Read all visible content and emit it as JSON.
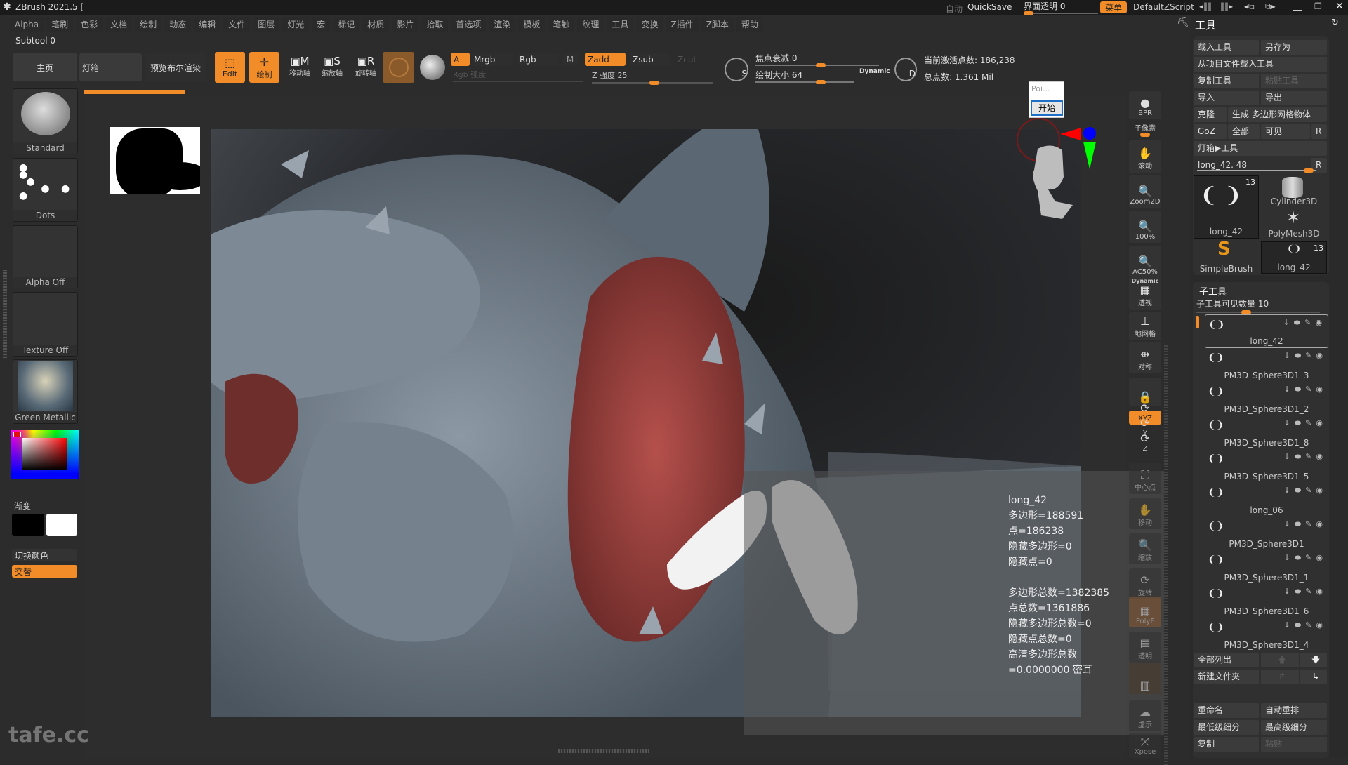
{
  "app": {
    "title": "ZBrush 2021.5 [",
    "auto": "自动",
    "quicksave": "QuickSave",
    "ui_opacity": "界面透明 0",
    "ui_opacity_value": 0,
    "menu": "菜单",
    "script": "DefaultZScript"
  },
  "menu": [
    "Alpha",
    "笔刷",
    "色彩",
    "文档",
    "绘制",
    "动态",
    "编辑",
    "文件",
    "图层",
    "灯光",
    "宏",
    "标记",
    "材质",
    "影片",
    "拾取",
    "首选项",
    "渲染",
    "模板",
    "笔触",
    "纹理",
    "工具",
    "变换",
    "Z插件",
    "Z脚本",
    "帮助"
  ],
  "subtool_label": "Subtool 0",
  "toolbar": {
    "home": "主页",
    "lightbox": "灯箱",
    "bool_preview": "预览布尔渲染",
    "edit": "Edit",
    "draw": "绘制",
    "move": "移动轴",
    "scale": "缩放轴",
    "rotate": "旋转轴",
    "a": "A",
    "mrgb": "Mrgb",
    "rgb": "Rgb",
    "m": "M",
    "rgb_intensity": "Rgb 强度",
    "zadd": "Zadd",
    "zsub": "Zsub",
    "zcut": "Zcut",
    "z_intensity": "Z 强度 25",
    "z_intensity_value": 25,
    "focal_shift": "焦点衰减 0",
    "draw_size": "绘制大小 64",
    "dynamic": "Dynamic",
    "s": "S",
    "d": "D",
    "active_points": "当前激活点数: 186,238",
    "total_points": "总点数: 1.361 Mil"
  },
  "left": {
    "brush": "Standard",
    "stroke": "Dots",
    "alpha": "Alpha Off",
    "texture": "Texture Off",
    "material": "Green Metallic",
    "gradient": "渐变",
    "switch_color": "切换颜色",
    "alternate": "交替",
    "main_color": "#e01010"
  },
  "popup": {
    "field": "Poi...",
    "start": "开始"
  },
  "stats": [
    "long_42",
    "多边形=188591",
    "点=186238",
    "隐藏多边形=0",
    "隐藏点=0",
    "",
    "多边形总数=1382385",
    "点总数=1361886",
    "隐藏多边形总数=0",
    "隐藏点总数=0",
    "高清多边形总数=0.0000000 密耳"
  ],
  "righttools": [
    "BPR",
    "子像素",
    "滚动",
    "Zoom2D",
    "100%",
    "AC50%",
    "透视",
    "地网格",
    "对称",
    "",
    "XYZ",
    "Y",
    "Z",
    "中心点",
    "移动",
    "缩放",
    "旋转",
    "PolyF",
    "透明",
    "",
    "虚示",
    "Xpose"
  ],
  "dynamic_label": "Dynamic",
  "tool": {
    "title": "工具",
    "load": "载入工具",
    "save_as": "另存为",
    "load_project": "从项目文件载入工具",
    "copy": "复制工具",
    "paste": "粘贴工具",
    "import": "导入",
    "export": "导出",
    "clone": "克隆",
    "make_polymesh": "生成 多边形网格物体",
    "goz": "GoZ",
    "all": "全部",
    "visible": "可见",
    "r": "R",
    "lightbox_tool": "灯箱▶工具",
    "slider": "long_42. 48",
    "slider_value": 48,
    "thumbs": [
      {
        "name": "long_42",
        "count": "13"
      },
      {
        "name": "Cylinder3D"
      },
      {
        "name": "PolyMesh3D"
      },
      {
        "name": "SimpleBrush"
      },
      {
        "name": "long_42",
        "count": "13"
      }
    ]
  },
  "subtool": {
    "title": "子工具",
    "visible_count": "子工具可见数量 10",
    "items": [
      "long_42",
      "PM3D_Sphere3D1_3",
      "PM3D_Sphere3D1_2",
      "PM3D_Sphere3D1_8",
      "PM3D_Sphere3D1_5",
      "long_06",
      "PM3D_Sphere3D1",
      "PM3D_Sphere3D1_1",
      "PM3D_Sphere3D1_6",
      "PM3D_Sphere3D1_4"
    ],
    "list_all": "全部列出",
    "new_folder": "新建文件夹",
    "rename": "重命名",
    "auto_reorder": "自动重排",
    "lowest_subdiv": "最低级细分",
    "highest_subdiv": "最高级细分",
    "duplicate": "复制",
    "paste": "粘贴"
  },
  "watermark": "tafe.cc",
  "accent": "#f28c28"
}
